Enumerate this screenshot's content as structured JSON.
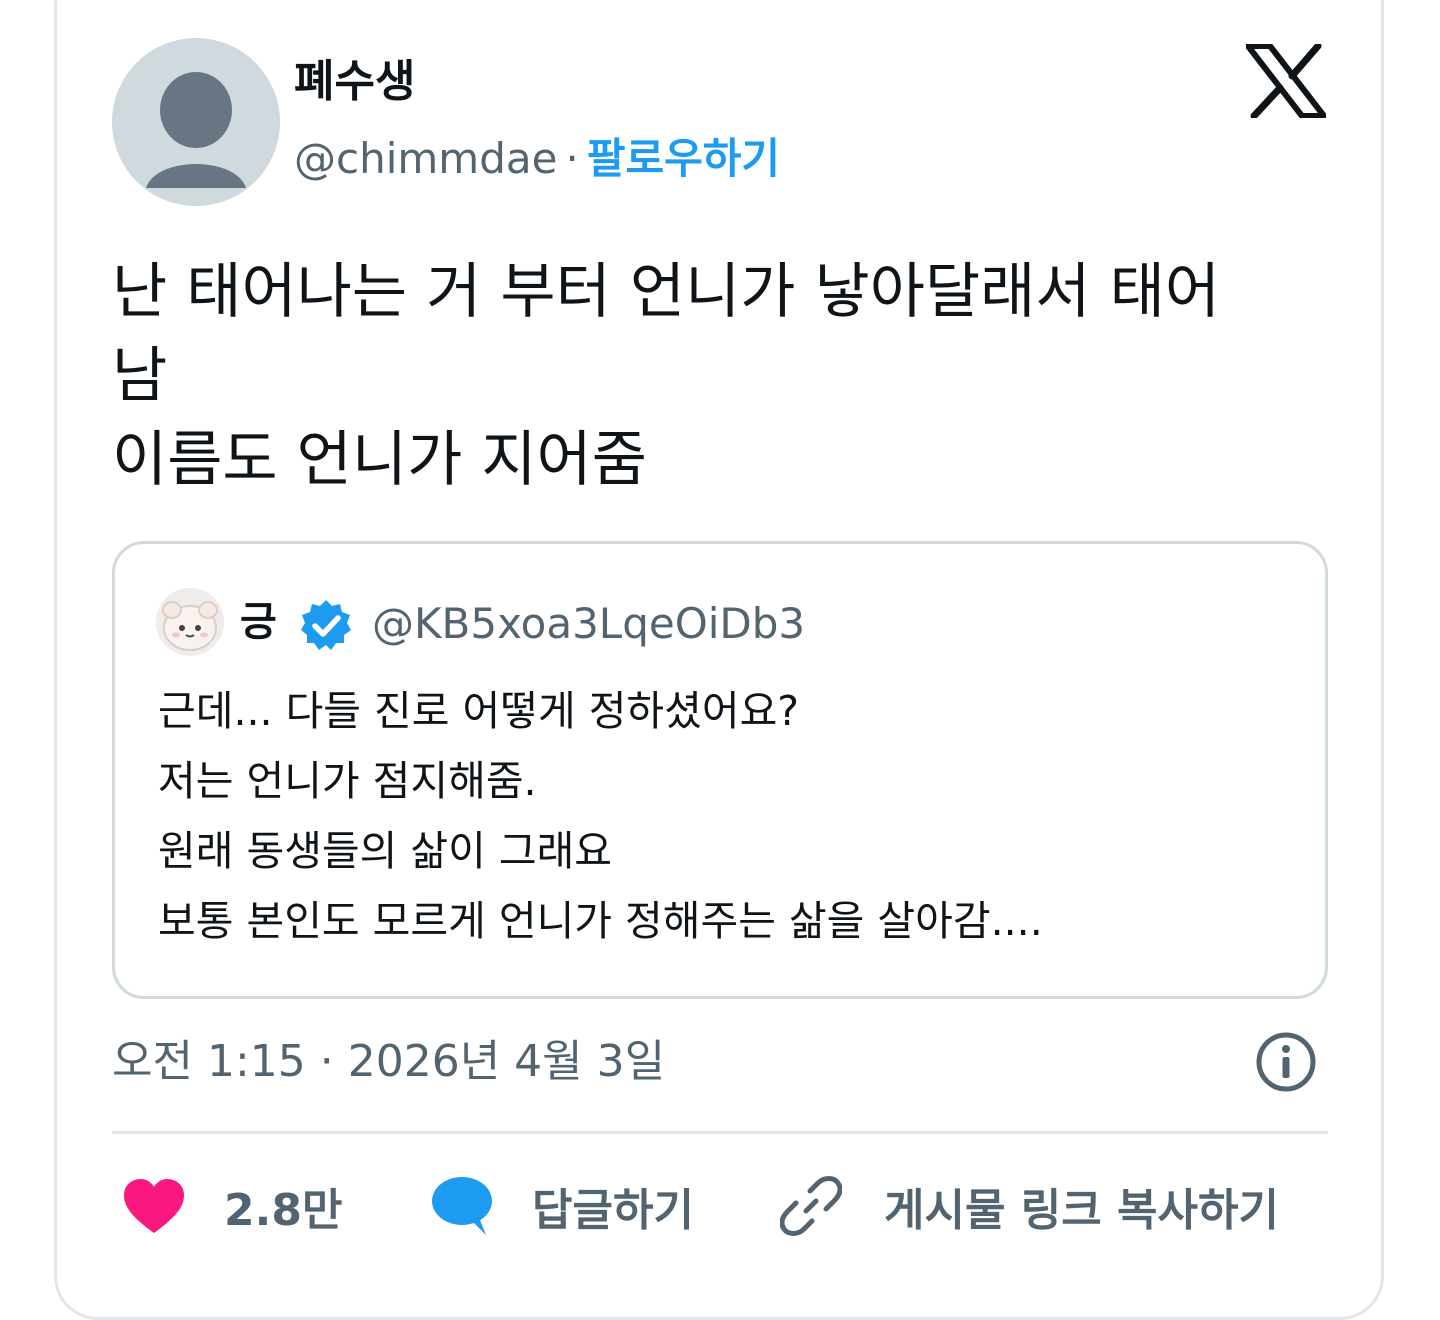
{
  "author": {
    "display_name": "폐수생",
    "handle": "@chimmdae",
    "separator": "·",
    "follow_label": "팔로우하기"
  },
  "tweet": {
    "text_lines": [
      "난 태어나는 거 부터 언니가 낳아달래서 태어",
      "남",
      "이름도 언니가 지어줌"
    ],
    "timestamp": "오전 1:15 · 2026년 4월 3일"
  },
  "quote": {
    "display_name": "긍",
    "handle": "@KB5xoa3LqeOiDb3",
    "verified": true,
    "text_lines": [
      "근데... 다들 진로 어떻게 정하셨어요?",
      "저는 언니가 점지해줌.",
      "원래 동생들의 삶이 그래요",
      "보통 본인도 모르게 언니가 정해주는 삶을 살아감...."
    ]
  },
  "actions": {
    "like_count": "2.8만",
    "reply_label": "답글하기",
    "copy_link_label": "게시물 링크 복사하기"
  },
  "icons": {
    "logo": "x-logo-icon",
    "verified": "verified-badge-icon",
    "info": "info-icon",
    "like": "heart-icon",
    "reply": "speech-bubble-icon",
    "link": "link-icon"
  },
  "colors": {
    "accent": "#1d9bf0",
    "like": "#f91880",
    "secondary_text": "#536471",
    "border": "#cfd9de"
  }
}
